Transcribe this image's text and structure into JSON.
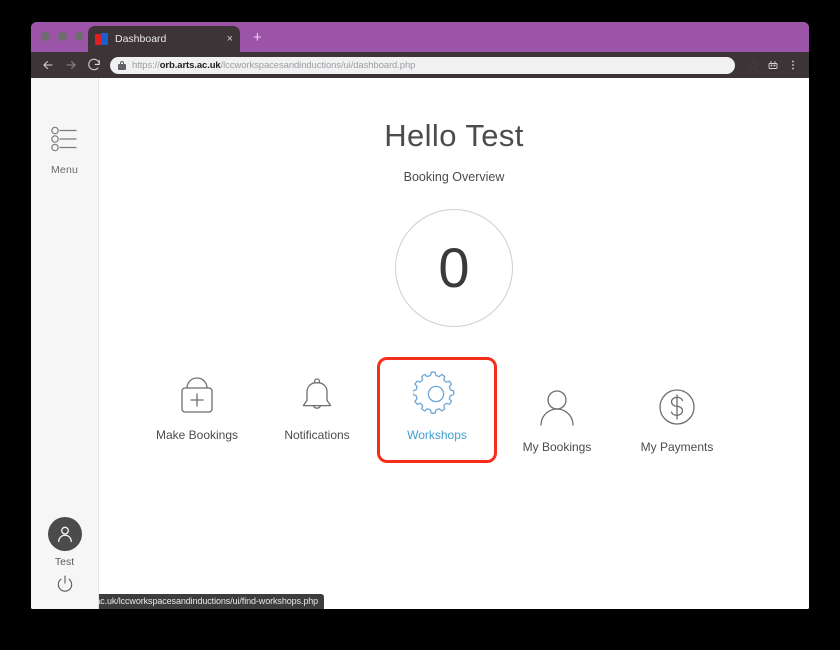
{
  "window": {
    "titlebar_color": "#9b54a8",
    "toolbar_color": "#3d3438"
  },
  "tab": {
    "title": "Dashboard",
    "close_label": "×",
    "favicon_name": "ual-logo-favicon",
    "new_tab_label": "+"
  },
  "toolbar": {
    "back_label": "back",
    "forward_label": "forward",
    "reload_label": "reload",
    "url_display": "https://orb.arts.ac.uk/lccworkspacesandinductions/ui/dashboard.php",
    "url_scheme": "https://",
    "url_domain": "orb.arts.ac.uk",
    "url_path": "/lccworkspacesandinductions/ui/dashboard.php",
    "bookmark_label": "Bookmark this page",
    "extension_label": "Extensions",
    "menu_label": "Customize and control"
  },
  "sidebar": {
    "menu_label": "Menu",
    "menu_icon": "sliders-icon",
    "user_name": "Test",
    "avatar_icon": "person-icon",
    "power_icon": "power-icon"
  },
  "main": {
    "greeting": "Hello Test",
    "subtitle": "Booking Overview",
    "count": "0",
    "tiles": [
      {
        "label": "Make Bookings",
        "icon": "shopping-bag-plus-icon",
        "highlighted": false
      },
      {
        "label": "Notifications",
        "icon": "bell-icon",
        "highlighted": false
      },
      {
        "label": "Workshops",
        "icon": "gear-icon",
        "highlighted": true
      },
      {
        "label": "My Bookings",
        "icon": "person-icon",
        "highlighted": false
      },
      {
        "label": "My Payments",
        "icon": "dollar-circle-icon",
        "highlighted": false
      }
    ]
  },
  "status_bar": {
    "url": "https://orb.arts.ac.uk/lccworkspacesandinductions/ui/find-workshops.php"
  },
  "colors": {
    "accent_purple": "#9b54a8",
    "highlight_red": "#f42e18",
    "link_blue": "#3f9fd4",
    "icon_gray": "#6e6e6e"
  }
}
